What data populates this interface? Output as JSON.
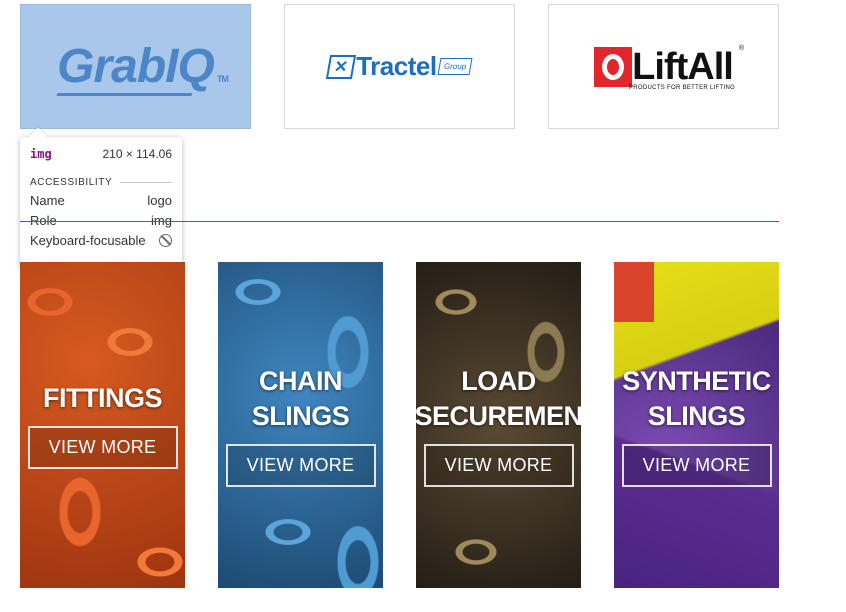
{
  "logos": [
    {
      "name": "GrabIQ",
      "text": "GrabIQ",
      "tm": "TM"
    },
    {
      "name": "Tractel",
      "text": "Tractel",
      "group": "Group"
    },
    {
      "name": "LiftAll",
      "text": "LiftAll",
      "reg": "®",
      "tagline": "PRODUCTS FOR BETTER LIFTING"
    }
  ],
  "inspector": {
    "tag": "img",
    "dimensions": "210 × 114.06",
    "section": "ACCESSIBILITY",
    "rows": [
      {
        "label": "Name",
        "value": "logo"
      },
      {
        "label": "Role",
        "value": "img"
      },
      {
        "label": "Keyboard-focusable",
        "value": ""
      }
    ]
  },
  "cards": [
    {
      "title_lines": [
        "FITTINGS"
      ],
      "button": "VIEW MORE"
    },
    {
      "title_lines": [
        "CHAIN",
        "SLINGS"
      ],
      "button": "VIEW MORE"
    },
    {
      "title_lines": [
        "LOAD",
        "SECUREMEN"
      ],
      "button": "VIEW MORE"
    },
    {
      "title_lines": [
        "SYNTHETIC",
        "SLINGS"
      ],
      "button": "VIEW MORE"
    }
  ],
  "colors": {
    "divider": "#c0392b",
    "highlight": "#a8c7ea",
    "tag_color": "#881280"
  }
}
